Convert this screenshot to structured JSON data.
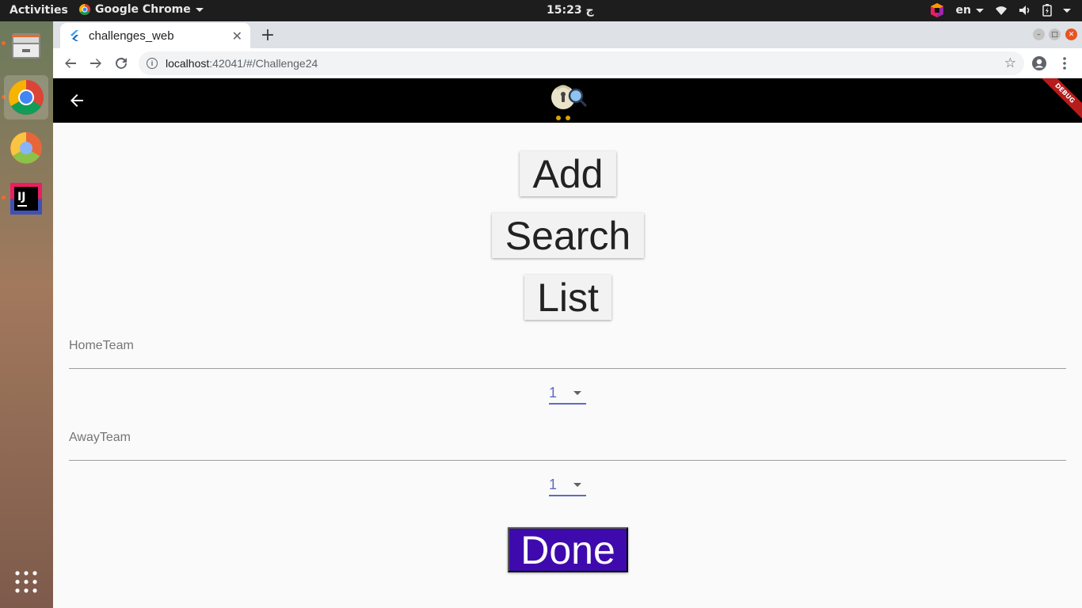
{
  "system": {
    "activities": "Activities",
    "app_name": "Google Chrome",
    "clock": "15:23 ج",
    "language": "en"
  },
  "browser": {
    "tab_title": "challenges_web",
    "url_host": "localhost",
    "url_path": ":42041/#/Challenge24"
  },
  "app": {
    "debug_banner": "DEBUG",
    "buttons": {
      "add": "Add",
      "search": "Search",
      "list": "List",
      "done": "Done"
    },
    "home_team": {
      "label": "HomeTeam",
      "selected": "1"
    },
    "away_team": {
      "label": "AwayTeam",
      "selected": "1"
    },
    "colors": {
      "done_bg": "#3f0aad",
      "dropdown_accent": "#5c6bc0",
      "appbar_bg": "#000000"
    }
  },
  "icons": {
    "dock": [
      "file-manager-icon",
      "chrome-icon",
      "chromium-icon",
      "intellij-icon",
      "show-apps-icon"
    ],
    "toolbar": [
      "back-icon",
      "forward-icon",
      "reload-icon",
      "info-icon",
      "star-icon",
      "account-icon",
      "menu-icon"
    ]
  }
}
